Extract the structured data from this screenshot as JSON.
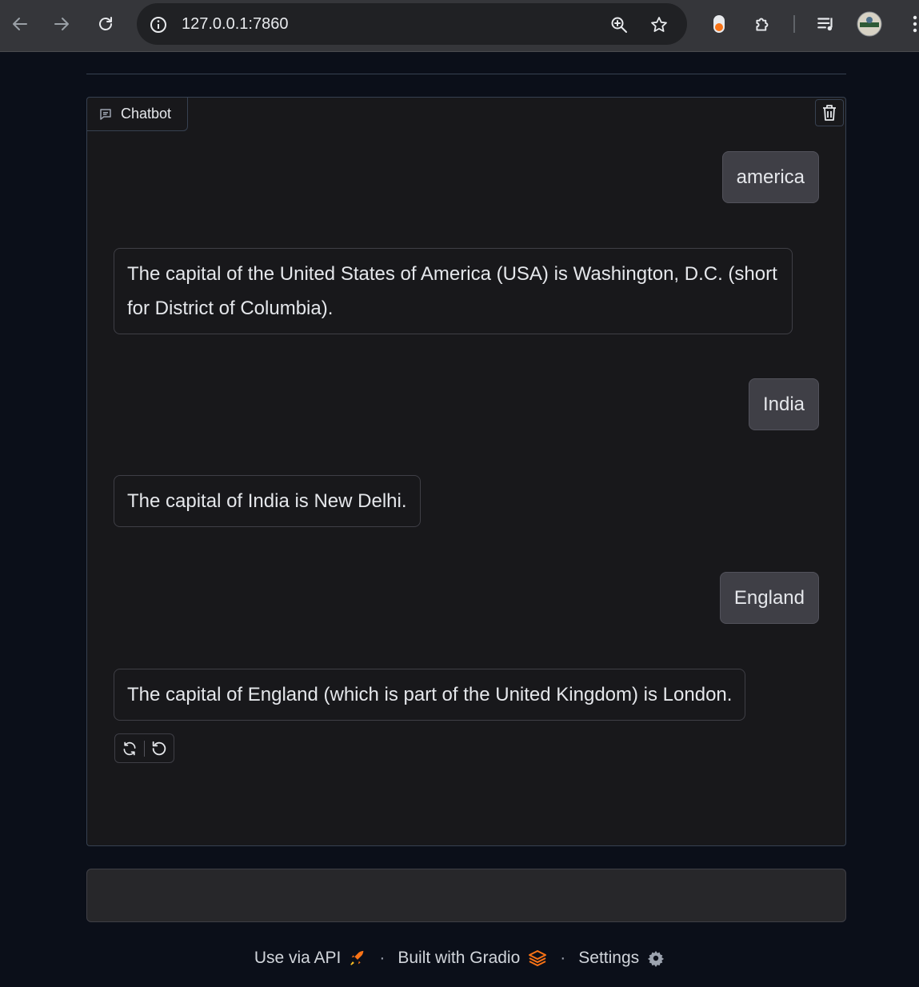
{
  "browser": {
    "url": "127.0.0.1:7860"
  },
  "chatbot": {
    "label": "Chatbot",
    "messages": [
      {
        "role": "user",
        "text": "america"
      },
      {
        "role": "bot",
        "text": "The capital of the United States of America (USA) is Washington, D.C. (short for District of Columbia)."
      },
      {
        "role": "user",
        "text": "India"
      },
      {
        "role": "bot",
        "text": "The capital of India is New Delhi."
      },
      {
        "role": "user",
        "text": "England"
      },
      {
        "role": "bot",
        "text": "The capital of England (which is part of the United Kingdom) is London."
      }
    ]
  },
  "input": {
    "value": "",
    "placeholder": ""
  },
  "footer": {
    "api_label": "Use via API",
    "separator": "·",
    "built_label": "Built with Gradio",
    "settings_label": "Settings"
  },
  "colors": {
    "page_bg": "#0b0f19",
    "panel_bg": "#18181b",
    "user_bubble": "#3f3f46",
    "gradio_orange": "#f97316"
  },
  "icons": {
    "back": "arrow-left-icon",
    "forward": "arrow-right-icon",
    "reload": "reload-icon",
    "site_info": "info-icon",
    "zoom": "zoom-icon",
    "bookmark": "star-icon",
    "extension": "puzzle-icon",
    "media": "media-queue-icon",
    "profile": "avatar",
    "menu": "kebab-menu-icon",
    "chat": "chat-icon",
    "clear": "trash-icon",
    "retry": "retry-icon",
    "undo": "undo-icon",
    "api": "rocket-icon",
    "gradio": "gradio-logo-icon",
    "settings": "gear-icon"
  }
}
